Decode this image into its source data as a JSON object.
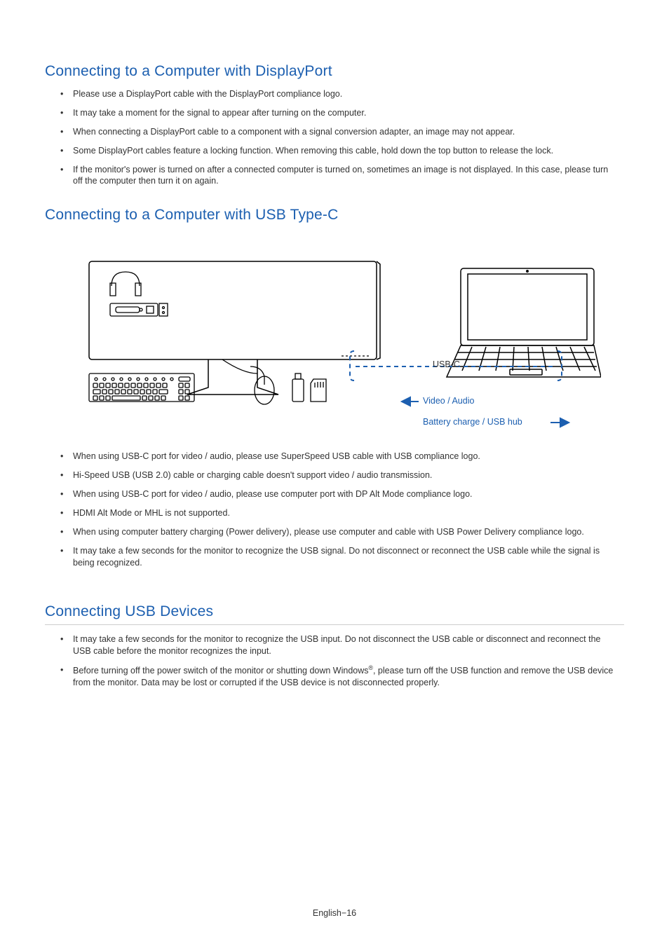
{
  "section1": {
    "title": "Connecting to a Computer with DisplayPort",
    "bullets": [
      "Please use a DisplayPort cable with the DisplayPort compliance logo.",
      "It may take a moment for the signal to appear after turning on the computer.",
      "When connecting a DisplayPort cable to a component with a signal conversion adapter, an image may not appear.",
      "Some DisplayPort cables feature a locking function. When removing this cable, hold down the top button to release the lock.",
      "If the monitor's power is turned on after a connected computer is turned on, sometimes an image is not displayed. In this case, please turn off the computer then turn it on again."
    ]
  },
  "section2": {
    "title": "Connecting to a Computer with USB Type-C",
    "diagram": {
      "usbc_label": "USB-C",
      "video_audio_label": "Video / Audio",
      "battery_label": "Battery charge / USB hub"
    },
    "bullets": [
      "When using USB-C port for video / audio, please use SuperSpeed USB cable with USB compliance logo.",
      "Hi-Speed USB (USB 2.0) cable or charging cable doesn't support video / audio transmission.",
      "When using USB-C port for video / audio, please use computer port with DP Alt Mode compliance logo.",
      "HDMI Alt Mode or MHL is not supported.",
      "When using computer battery charging (Power delivery), please use computer and cable with USB Power Delivery compliance logo.",
      "It may take a few seconds for the monitor to recognize the USB signal. Do not disconnect or reconnect the USB cable while the signal is being recognized."
    ]
  },
  "section3": {
    "title": "Connecting USB Devices",
    "bullets": [
      "It may take a few seconds for the monitor to recognize the USB input. Do not disconnect the USB cable or disconnect and reconnect the USB cable before the monitor recognizes the input.",
      "Before turning off the power switch of the monitor or shutting down Windows®, please turn off the USB function and remove the USB device from the monitor. Data may be lost or corrupted if the USB device is not disconnected properly."
    ]
  },
  "footer": "English−16"
}
